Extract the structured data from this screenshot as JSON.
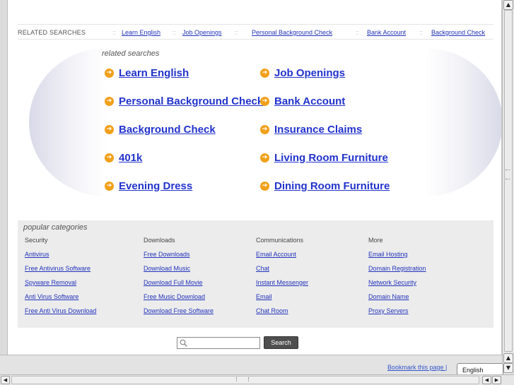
{
  "related_bar": {
    "label": "RELATED SEARCHES",
    "separator": "::",
    "links": [
      "Learn English",
      "Job Openings",
      "Personal Background Check",
      "Bank Account",
      "Background Check"
    ]
  },
  "related_searches": {
    "title": "related searches",
    "left_column": [
      "Learn English",
      "Personal Background Check",
      "Background Check",
      "401k",
      "Evening Dress"
    ],
    "right_column": [
      "Job Openings",
      "Bank Account",
      "Insurance Claims",
      "Living Room Furniture",
      "Dining Room Furniture"
    ],
    "bullet_icon": "arrow-circle-icon",
    "bullet_glyph": "➔",
    "bullet_color": "#f1a01a",
    "link_color": "#2233cc"
  },
  "popular": {
    "title": "popular categories",
    "columns": [
      {
        "heading": "Security",
        "links": [
          "Antivirus",
          "Free Antivirus Software",
          "Spyware Removal",
          "Anti Virus Software",
          "Free Anti Virus Download"
        ]
      },
      {
        "heading": "Downloads",
        "links": [
          "Free Downloads",
          "Download Music",
          "Download Full Movie",
          "Free Music Download",
          "Download Free Software"
        ]
      },
      {
        "heading": "Communications",
        "links": [
          "Email Account",
          "Chat",
          "Instant Messenger",
          "Email",
          "Chat Room"
        ]
      },
      {
        "heading": "More",
        "links": [
          "Email Hosting",
          "Domain Registration",
          "Network Security",
          "Domain Name",
          "Proxy Servers"
        ]
      }
    ]
  },
  "search": {
    "value": "",
    "button_label": "Search",
    "icon": "magnifier-icon"
  },
  "footer": {
    "bookmark_label": "Bookmark this page |",
    "language": "English"
  },
  "scrollbars": {
    "up_glyph": "▲",
    "down_glyph": "▼",
    "left_glyph": "◀",
    "right_glyph": "▶"
  }
}
